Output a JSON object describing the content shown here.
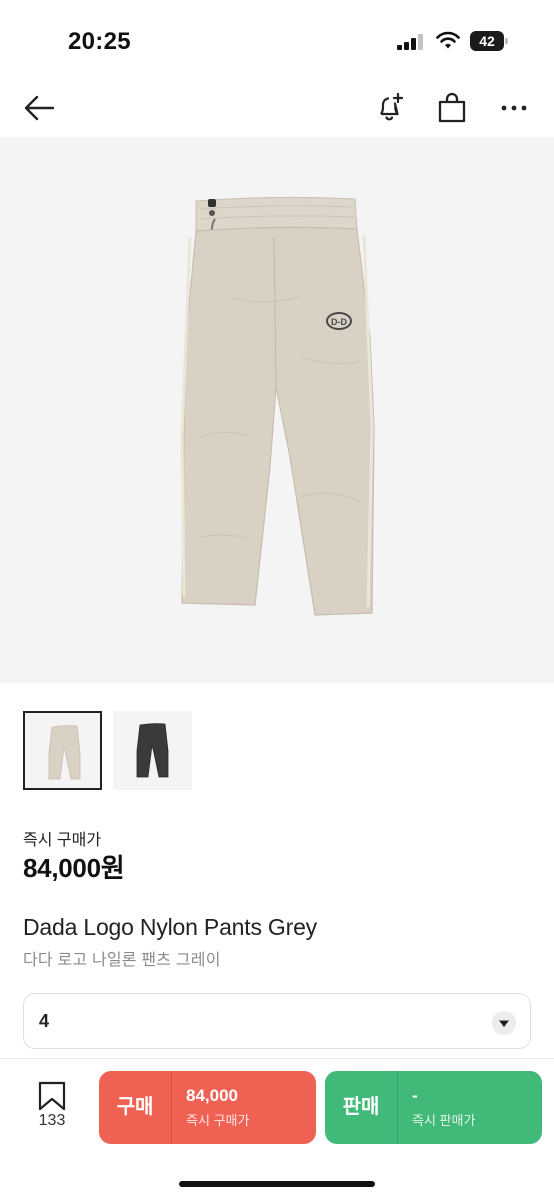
{
  "status_bar": {
    "time": "20:25",
    "battery": "42"
  },
  "nav": {
    "back_icon": "arrow-left-icon",
    "alert_icon": "bell-plus-icon",
    "bag_icon": "shopping-bag-icon",
    "more_icon": "ellipsis-icon"
  },
  "product": {
    "image_colors": {
      "beige": "#d8d1c4",
      "black": "#3a3a3d"
    },
    "price_label": "즉시 구매가",
    "price": "84,000원",
    "name": "Dada Logo Nylon Pants Grey",
    "name_ko": "다다 로고 나일론 팬츠 그레이",
    "size": "4",
    "logo_text": "D-D"
  },
  "bottom_bar": {
    "wish_count": "133",
    "buy": {
      "label": "구매",
      "price": "84,000",
      "sub": "즉시 구매가",
      "color": "#ef6253"
    },
    "sell": {
      "label": "판매",
      "price": "-",
      "sub": "즉시 판매가",
      "color": "#41b979"
    }
  }
}
